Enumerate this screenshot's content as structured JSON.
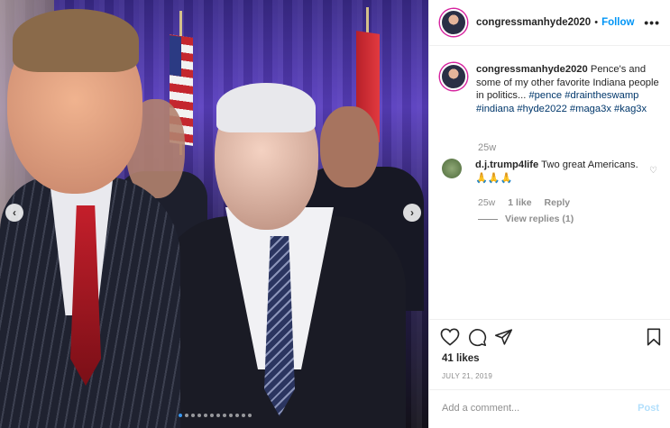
{
  "post": {
    "photo_alt": "",
    "carousel": {
      "count": 12,
      "active": 0
    }
  },
  "header": {
    "username": "congressmanhyde2020",
    "separator": "•",
    "follow_label": "Follow",
    "more_label": "•••"
  },
  "caption": {
    "username": "congressmanhyde2020",
    "text": "Pence's and some of my other favorite Indiana people in politics...",
    "hashtags": [
      "#pence",
      "#draintheswamp",
      "#indiana",
      "#hyde2022",
      "#maga3x",
      "#kag3x"
    ],
    "time": "25w"
  },
  "comment": {
    "username": "d.j.trump4life",
    "text": "Two great Americans. 🙏🙏🙏",
    "time": "25w",
    "likes": "1 like",
    "reply_label": "Reply",
    "view_replies": "View replies (1)"
  },
  "footer": {
    "likes": "41 likes",
    "date": "JULY 21, 2019",
    "add_comment_placeholder": "Add a comment...",
    "post_label": "Post"
  },
  "colors": {
    "link": "#0095f6",
    "hashtag": "#00376b",
    "meta": "#8e8e8e"
  }
}
